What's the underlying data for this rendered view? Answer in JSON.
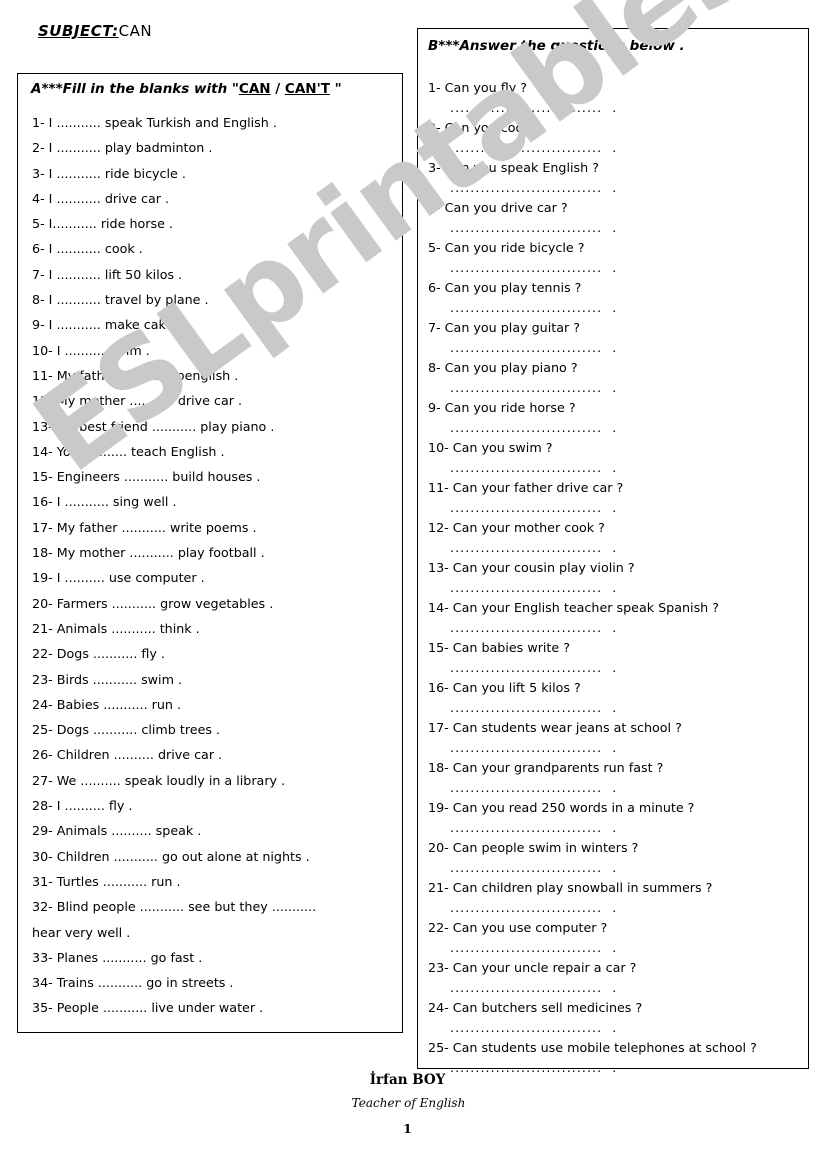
{
  "subject": {
    "label": "SUBJECT:",
    "value": "CAN"
  },
  "watermark": {
    "text": "ESLprintables.com",
    "color": "#c9c9c9"
  },
  "exercise_a": {
    "heading_prefix": "A***Fill in the blanks with \"",
    "heading_option_1": "CAN",
    "heading_separator": " / ",
    "heading_option_2": "CAN'T",
    "heading_suffix": "  \"",
    "items": [
      "1-  I ...........  speak Turkish and English .",
      "2-  I ...........  play badminton .",
      "3-  I ...........  ride bicycle .",
      "4-  I ...........  drive car .",
      "5-  I...........  ride horse .",
      "6-  I ...........  cook .",
      "7-  I ...........  lift 50 kilos .",
      "8-  I ...........  travel by plane .",
      "9-  I ...........  make cake .",
      "10- I ..........  swim .",
      "11- My father ...........  spenglish .",
      "12- My mother ...........  drive car .",
      "13- My best friend ...........  play piano .",
      "14- You ...........  teach English .",
      "15- Engineers ...........  build houses .",
      "16- I ...........  sing well .",
      "17- My father ...........  write poems .",
      "18- My mother ...........  play football .",
      "19- I ..........  use computer .",
      "20- Farmers ...........  grow vegetables .",
      "21- Animals ...........  think .",
      "22- Dogs ...........  fly .",
      "23- Birds ...........  swim .",
      "24- Babies ...........  run .",
      "25- Dogs ...........  climb trees .",
      "26- Children ..........  drive car .",
      "27- We ..........  speak loudly in a library .",
      "28- I ..........  fly .",
      "29- Animals ..........  speak .",
      "30- Children ...........  go out alone at nights .",
      "31- Turtles ...........  run .",
      "32- Blind people ...........  see but they ...........",
      "hear very well .",
      "33- Planes ...........  go fast .",
      "34- Trains ...........  go in streets .",
      "35- People ...........  live under water ."
    ]
  },
  "exercise_b": {
    "heading": "B***Answer the questions below .",
    "answer_dots": "..............................",
    "answer_tail": ".",
    "questions": [
      "1-  Can you fly ?",
      "2-  Can you cook ?",
      "3-  Can you speak English ?",
      "4-  Can you drive car ?",
      "5-  Can you ride bicycle ?",
      "6-  Can you play tennis ?",
      "7-  Can you play guitar ?",
      "8-  Can you play piano ?",
      "9-  Can you ride horse ?",
      "10- Can you swim ?",
      "11- Can your father drive car ?",
      "12- Can your mother cook ?",
      "13- Can your cousin play violin ?",
      "14- Can your English teacher speak Spanish ?",
      "15- Can babies write ?",
      "16- Can you lift 5 kilos ?",
      "17- Can students wear jeans at school ?",
      "18- Can your grandparents run fast ?",
      "19- Can you read 250 words in a minute ?",
      "20- Can people swim in winters ?",
      "21- Can children play snowball in summers ?",
      "22- Can you use computer ?",
      "23- Can your uncle repair a car ?",
      "24- Can butchers sell medicines ?",
      "25- Can students use mobile telephones at school ?"
    ]
  },
  "footer": {
    "teacher_name": "İrfan BOY",
    "teacher_title": "Teacher of English",
    "page_number": "1"
  }
}
